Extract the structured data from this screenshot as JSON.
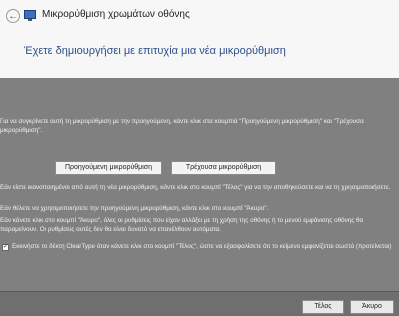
{
  "window": {
    "title": "Μικρορύθμιση χρωμάτων οθόνης"
  },
  "header": {
    "heading": "Έχετε δημιουργήσει με επιτυχία μια νέα μικρορύθμιση"
  },
  "content": {
    "p1": "Για να συγκρίνετε αυτή τη μικρορύθμιση με την προηγούμενη, κάντε κλικ στα κουμπιά \"Προηγούμενη μικρορύθμιση\" και \"Τρέχουσα μικρορύθμιση\".",
    "previous_button": "Προηγούμενη μικρορύθμιση",
    "current_button": "Τρέχουσα μικρορύθμιση",
    "p2": "Εάν είστε ικανοποιημένοι από αυτή τη νέα μικρορύθμιση, κάντε κλικ στο κουμπί \"Τέλος\" για να την αποθηκεύσετε και να τη χρησιμοποιήσετε.",
    "p3": "Εάν θέλετε να χρησιμοποιήσετε την προηγούμενη μικρορύθμιση, κάντε κλικ στο κουμπί \"Άκυρο\".",
    "p4": "Εάν κάνετε κλικ στο κουμπί \"Άκυρο\", όλες οι ρυθμίσεις που είχαν αλλάξει με τη χρήση της οθόνης ή το μενού εμφάνισης οθόνης θα παραμείνουν. Οι ρυθμίσεις αυτές δεν θα είναι δυνατό να επανέλθουν αυτόματα.",
    "cleartype_label": "Εκκινήστε το δέκτη ClearType όταν κάνετε κλικ στο κουμπί \"Τέλος\", ώστε να εξασφαλίσετε ότι το κείμενο εμφανίζεται σωστά (προτείνεται)",
    "cleartype_checked": true
  },
  "footer": {
    "finish_button": "Τέλος",
    "cancel_button": "Άκυρο"
  },
  "colors": {
    "accent": "#2d4f8a",
    "body_bg": "#808080"
  }
}
